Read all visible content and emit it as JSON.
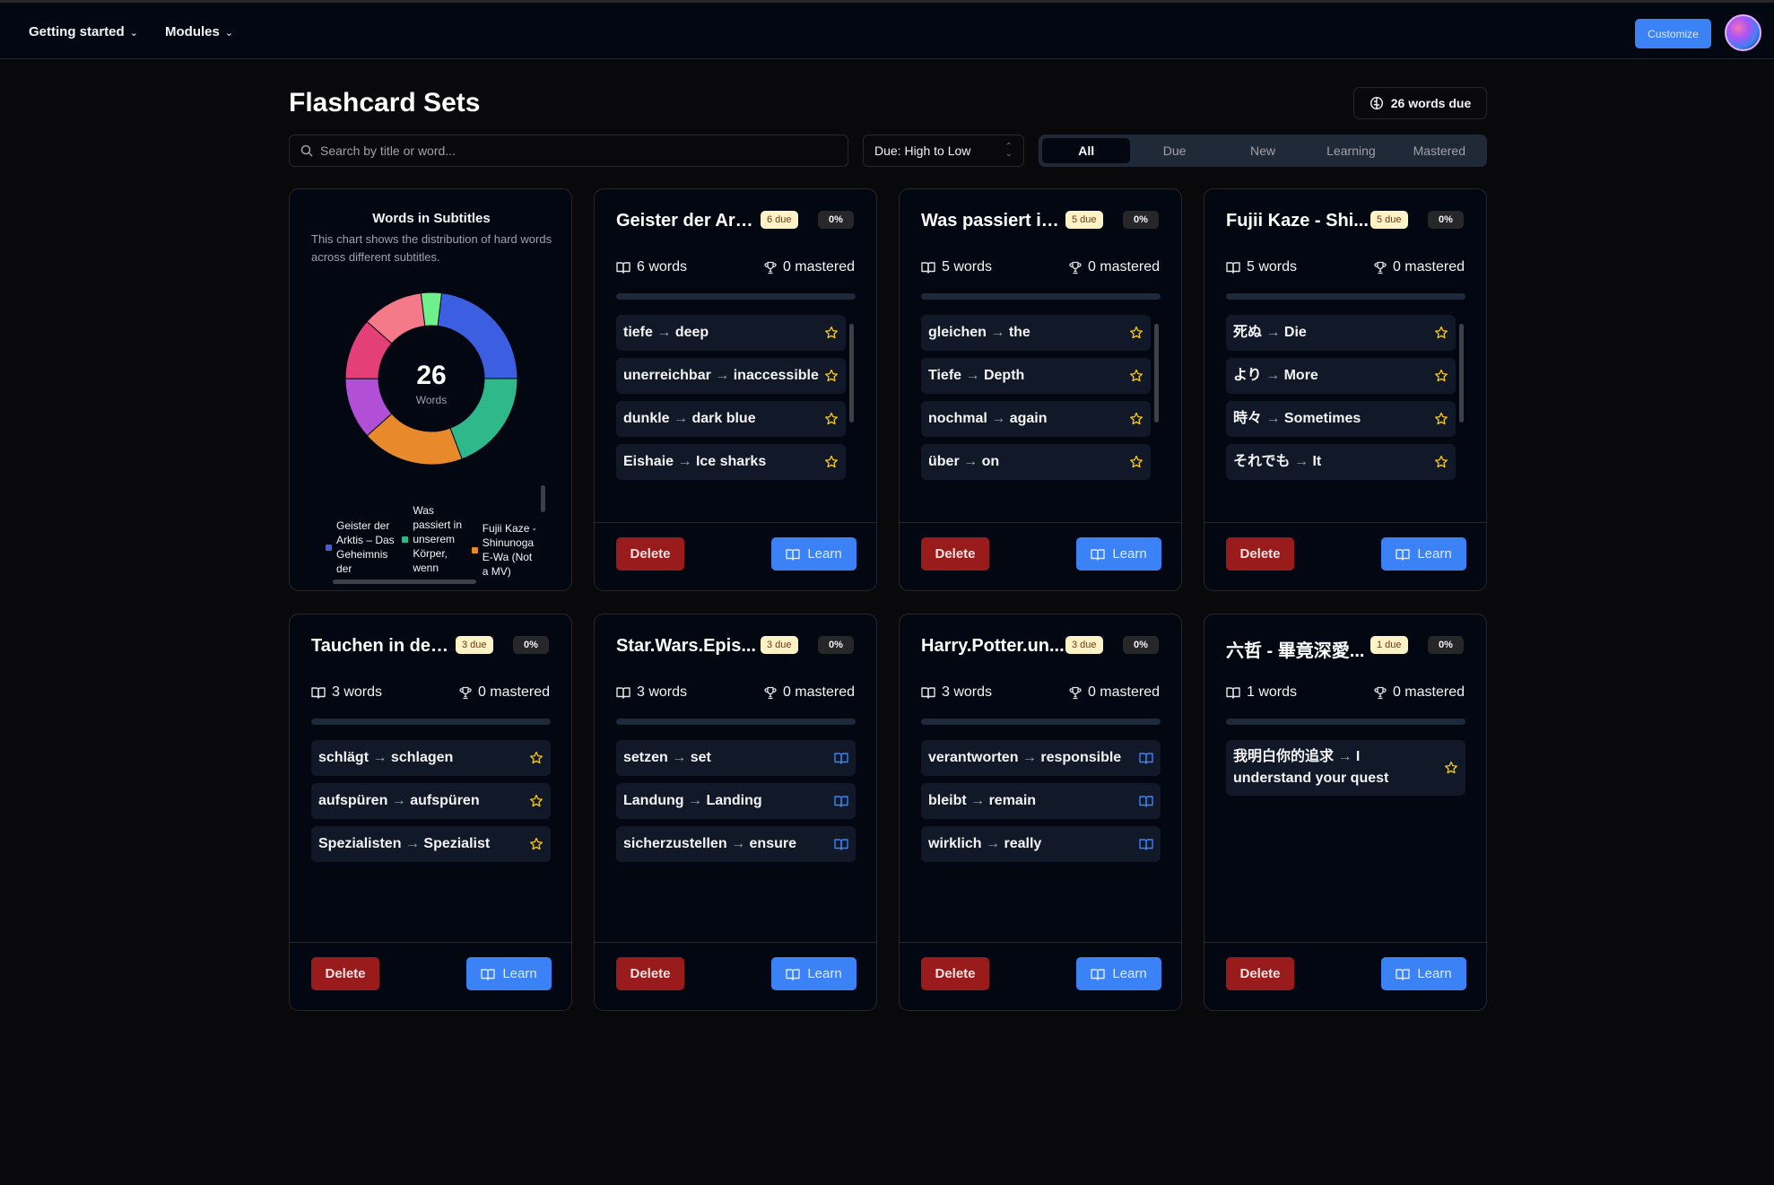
{
  "nav": {
    "getting_started": "Getting started",
    "modules": "Modules",
    "customize": "Customize"
  },
  "header": {
    "title": "Flashcard Sets",
    "due_pill": "26 words due"
  },
  "search": {
    "placeholder": "Search by title or word..."
  },
  "sort": {
    "selected": "Due: High to Low"
  },
  "filters": [
    {
      "label": "All",
      "active": true
    },
    {
      "label": "Due",
      "active": false
    },
    {
      "label": "New",
      "active": false
    },
    {
      "label": "Learning",
      "active": false
    },
    {
      "label": "Mastered",
      "active": false
    }
  ],
  "chart_card": {
    "title": "Words in Subtitles",
    "description": "This chart shows the distribution of hard words across different subtitles.",
    "center_value": "26",
    "center_label": "Words",
    "legend": [
      {
        "label": "Geister der Arktis – Das Geheimnis der",
        "color": "#3b5fe0"
      },
      {
        "label": "Was passiert in unserem Körper, wenn",
        "color": "#2fb98b"
      },
      {
        "label": "Fujii Kaze - Shinunoga E-Wa (Not a MV)",
        "color": "#e88a2b"
      }
    ]
  },
  "chart_data": {
    "type": "pie",
    "title": "Words in Subtitles",
    "categories": [
      "Geister der Arktis",
      "Was passiert in unserem Körper",
      "Fujii Kaze - Shinunoga E-Wa",
      "Tauchen in der ...",
      "Star.Wars.Epis...",
      "Harry.Potter.un...",
      "六哲 - 畢竟深愛..."
    ],
    "values": [
      6,
      5,
      5,
      3,
      3,
      3,
      1
    ],
    "colors": [
      "#3b5fe0",
      "#2fb98b",
      "#e88a2b",
      "#b14fd6",
      "#e43f77",
      "#f47a8a",
      "#6ef08a"
    ],
    "total": 26
  },
  "labels": {
    "mastered_suffix": "0 mastered",
    "delete": "Delete",
    "learn": "Learn"
  },
  "sets": [
    {
      "title": "Geister der Ark...",
      "due": "6 due",
      "pct": "0%",
      "words": "6 words",
      "mastered": "0 mastered",
      "progress": 0,
      "items": [
        {
          "src": "tiefe",
          "tgt": "deep",
          "icon": "star"
        },
        {
          "src": "unerreichbar",
          "tgt": "inaccessible",
          "icon": "star"
        },
        {
          "src": "dunkle",
          "tgt": "dark blue",
          "icon": "star"
        },
        {
          "src": "Eishaie",
          "tgt": "Ice sharks",
          "icon": "star"
        }
      ]
    },
    {
      "title": "Was passiert in...",
      "due": "5 due",
      "pct": "0%",
      "words": "5 words",
      "mastered": "0 mastered",
      "progress": 0,
      "items": [
        {
          "src": "gleichen",
          "tgt": "the",
          "icon": "star"
        },
        {
          "src": "Tiefe",
          "tgt": "Depth",
          "icon": "star"
        },
        {
          "src": "nochmal",
          "tgt": "again",
          "icon": "star"
        },
        {
          "src": "über",
          "tgt": "on",
          "icon": "star"
        }
      ]
    },
    {
      "title": "Fujii Kaze - Shi...",
      "due": "5 due",
      "pct": "0%",
      "words": "5 words",
      "mastered": "0 mastered",
      "progress": 0,
      "items": [
        {
          "src": "死ぬ",
          "tgt": "Die",
          "icon": "star"
        },
        {
          "src": "より",
          "tgt": "More",
          "icon": "star"
        },
        {
          "src": "時々",
          "tgt": "Sometimes",
          "icon": "star"
        },
        {
          "src": "それでも",
          "tgt": "It",
          "icon": "star"
        }
      ]
    },
    {
      "title": "Tauchen in der ...",
      "due": "3 due",
      "pct": "0%",
      "words": "3 words",
      "mastered": "0 mastered",
      "progress": 0,
      "items": [
        {
          "src": "schlägt",
          "tgt": "schlagen",
          "icon": "star"
        },
        {
          "src": "aufspüren",
          "tgt": "aufspüren",
          "icon": "star"
        },
        {
          "src": "Spezialisten",
          "tgt": "Spezialist",
          "icon": "star"
        }
      ]
    },
    {
      "title": "Star.Wars.Epis...",
      "due": "3 due",
      "pct": "0%",
      "words": "3 words",
      "mastered": "0 mastered",
      "progress": 0,
      "items": [
        {
          "src": "setzen",
          "tgt": "set",
          "icon": "book"
        },
        {
          "src": "Landung",
          "tgt": "Landing",
          "icon": "book"
        },
        {
          "src": "sicherzustellen",
          "tgt": "ensure",
          "icon": "book"
        }
      ]
    },
    {
      "title": "Harry.Potter.un...",
      "due": "3 due",
      "pct": "0%",
      "words": "3 words",
      "mastered": "0 mastered",
      "progress": 0,
      "items": [
        {
          "src": "verantworten",
          "tgt": "responsible",
          "icon": "book"
        },
        {
          "src": "bleibt",
          "tgt": "remain",
          "icon": "book"
        },
        {
          "src": "wirklich",
          "tgt": "really",
          "icon": "book"
        }
      ]
    },
    {
      "title": "六哲 - 畢竟深愛...",
      "due": "1 due",
      "pct": "0%",
      "words": "1 words",
      "mastered": "0 mastered",
      "progress": 0,
      "items": [
        {
          "src": "我明白你的追求",
          "tgt": "I understand your quest",
          "icon": "star"
        }
      ]
    }
  ]
}
